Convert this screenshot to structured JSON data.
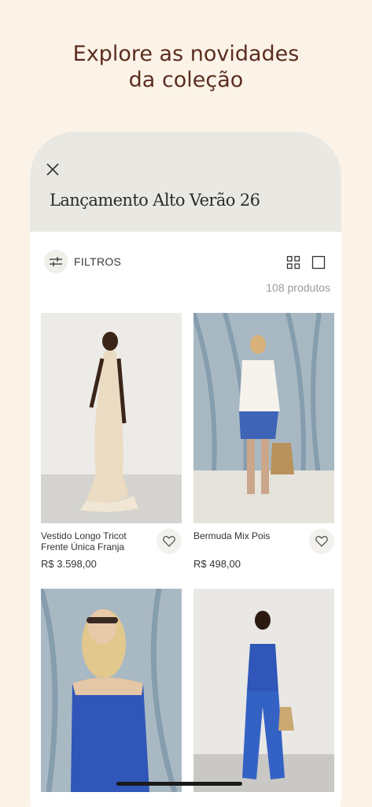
{
  "promo": {
    "line1": "Explore as novidades",
    "line2": "da coleção"
  },
  "header": {
    "title": "Lançamento Alto Verão 26"
  },
  "toolbar": {
    "filters_label": "FILTROS",
    "count": "108 produtos"
  },
  "products": [
    {
      "name": "Vestido Longo Tricot Frente Única Franja",
      "price": "R$ 3.598,00",
      "image": "woman-in-crochet-dress-photo"
    },
    {
      "name": "Bermuda Mix Pois",
      "price": "R$ 498,00",
      "image": "woman-in-white-shirt-blue-shorts-photo"
    },
    {
      "name": "",
      "price": "",
      "image": "woman-in-blue-print-top-photo"
    },
    {
      "name": "",
      "price": "",
      "image": "woman-in-blue-print-set-photo"
    }
  ],
  "colors": {
    "background": "#fcf3e8",
    "title": "#5a2d1f",
    "header": "#e9e8e2",
    "dress_blue": "#2f56b8"
  }
}
